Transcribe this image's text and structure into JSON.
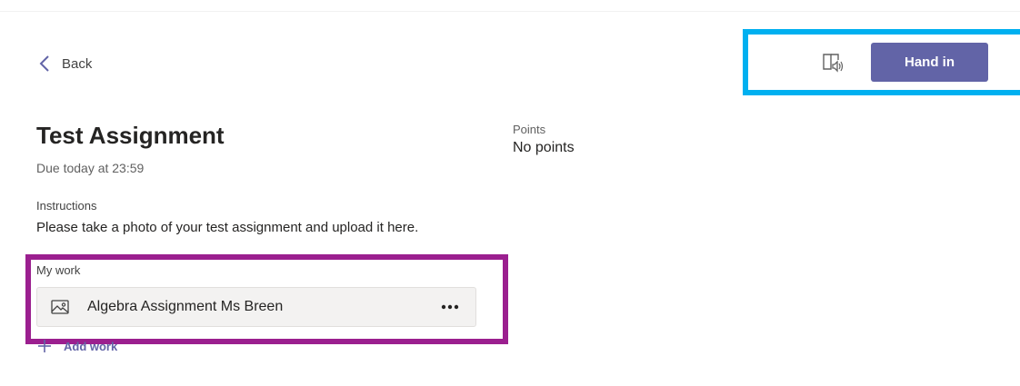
{
  "nav": {
    "back_label": "Back"
  },
  "toolbar": {
    "immersive_reader_icon": "immersive-reader-icon",
    "hand_in_label": "Hand in"
  },
  "assignment": {
    "title": "Test Assignment",
    "due": "Due today at 23:59",
    "points_label": "Points",
    "points_value": "No points",
    "instructions_label": "Instructions",
    "instructions_text": "Please take a photo of your test assignment and upload it here."
  },
  "my_work": {
    "label": "My work",
    "items": [
      {
        "name": "Algebra Assignment Ms Breen",
        "icon": "image-file-icon",
        "menu_icon": "more-options-icon"
      }
    ],
    "add_work_label": "Add work"
  },
  "colors": {
    "accent": "#6264a7",
    "annotation_blue": "#00b0f0",
    "annotation_purple": "#9b1f8f"
  }
}
